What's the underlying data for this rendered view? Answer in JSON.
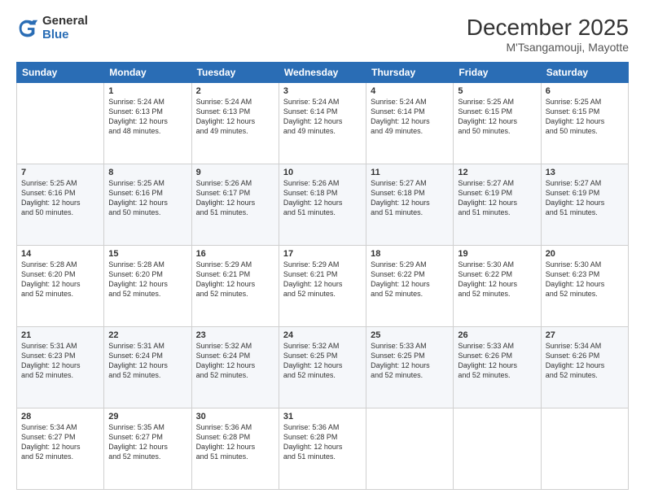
{
  "logo": {
    "line1": "General",
    "line2": "Blue"
  },
  "title": "December 2025",
  "subtitle": "M'Tsangamouji, Mayotte",
  "days_of_week": [
    "Sunday",
    "Monday",
    "Tuesday",
    "Wednesday",
    "Thursday",
    "Friday",
    "Saturday"
  ],
  "weeks": [
    [
      {
        "day": "",
        "info": ""
      },
      {
        "day": "1",
        "info": "Sunrise: 5:24 AM\nSunset: 6:13 PM\nDaylight: 12 hours\nand 48 minutes."
      },
      {
        "day": "2",
        "info": "Sunrise: 5:24 AM\nSunset: 6:13 PM\nDaylight: 12 hours\nand 49 minutes."
      },
      {
        "day": "3",
        "info": "Sunrise: 5:24 AM\nSunset: 6:14 PM\nDaylight: 12 hours\nand 49 minutes."
      },
      {
        "day": "4",
        "info": "Sunrise: 5:24 AM\nSunset: 6:14 PM\nDaylight: 12 hours\nand 49 minutes."
      },
      {
        "day": "5",
        "info": "Sunrise: 5:25 AM\nSunset: 6:15 PM\nDaylight: 12 hours\nand 50 minutes."
      },
      {
        "day": "6",
        "info": "Sunrise: 5:25 AM\nSunset: 6:15 PM\nDaylight: 12 hours\nand 50 minutes."
      }
    ],
    [
      {
        "day": "7",
        "info": "Sunrise: 5:25 AM\nSunset: 6:16 PM\nDaylight: 12 hours\nand 50 minutes."
      },
      {
        "day": "8",
        "info": "Sunrise: 5:25 AM\nSunset: 6:16 PM\nDaylight: 12 hours\nand 50 minutes."
      },
      {
        "day": "9",
        "info": "Sunrise: 5:26 AM\nSunset: 6:17 PM\nDaylight: 12 hours\nand 51 minutes."
      },
      {
        "day": "10",
        "info": "Sunrise: 5:26 AM\nSunset: 6:18 PM\nDaylight: 12 hours\nand 51 minutes."
      },
      {
        "day": "11",
        "info": "Sunrise: 5:27 AM\nSunset: 6:18 PM\nDaylight: 12 hours\nand 51 minutes."
      },
      {
        "day": "12",
        "info": "Sunrise: 5:27 AM\nSunset: 6:19 PM\nDaylight: 12 hours\nand 51 minutes."
      },
      {
        "day": "13",
        "info": "Sunrise: 5:27 AM\nSunset: 6:19 PM\nDaylight: 12 hours\nand 51 minutes."
      }
    ],
    [
      {
        "day": "14",
        "info": "Sunrise: 5:28 AM\nSunset: 6:20 PM\nDaylight: 12 hours\nand 52 minutes."
      },
      {
        "day": "15",
        "info": "Sunrise: 5:28 AM\nSunset: 6:20 PM\nDaylight: 12 hours\nand 52 minutes."
      },
      {
        "day": "16",
        "info": "Sunrise: 5:29 AM\nSunset: 6:21 PM\nDaylight: 12 hours\nand 52 minutes."
      },
      {
        "day": "17",
        "info": "Sunrise: 5:29 AM\nSunset: 6:21 PM\nDaylight: 12 hours\nand 52 minutes."
      },
      {
        "day": "18",
        "info": "Sunrise: 5:29 AM\nSunset: 6:22 PM\nDaylight: 12 hours\nand 52 minutes."
      },
      {
        "day": "19",
        "info": "Sunrise: 5:30 AM\nSunset: 6:22 PM\nDaylight: 12 hours\nand 52 minutes."
      },
      {
        "day": "20",
        "info": "Sunrise: 5:30 AM\nSunset: 6:23 PM\nDaylight: 12 hours\nand 52 minutes."
      }
    ],
    [
      {
        "day": "21",
        "info": "Sunrise: 5:31 AM\nSunset: 6:23 PM\nDaylight: 12 hours\nand 52 minutes."
      },
      {
        "day": "22",
        "info": "Sunrise: 5:31 AM\nSunset: 6:24 PM\nDaylight: 12 hours\nand 52 minutes."
      },
      {
        "day": "23",
        "info": "Sunrise: 5:32 AM\nSunset: 6:24 PM\nDaylight: 12 hours\nand 52 minutes."
      },
      {
        "day": "24",
        "info": "Sunrise: 5:32 AM\nSunset: 6:25 PM\nDaylight: 12 hours\nand 52 minutes."
      },
      {
        "day": "25",
        "info": "Sunrise: 5:33 AM\nSunset: 6:25 PM\nDaylight: 12 hours\nand 52 minutes."
      },
      {
        "day": "26",
        "info": "Sunrise: 5:33 AM\nSunset: 6:26 PM\nDaylight: 12 hours\nand 52 minutes."
      },
      {
        "day": "27",
        "info": "Sunrise: 5:34 AM\nSunset: 6:26 PM\nDaylight: 12 hours\nand 52 minutes."
      }
    ],
    [
      {
        "day": "28",
        "info": "Sunrise: 5:34 AM\nSunset: 6:27 PM\nDaylight: 12 hours\nand 52 minutes."
      },
      {
        "day": "29",
        "info": "Sunrise: 5:35 AM\nSunset: 6:27 PM\nDaylight: 12 hours\nand 52 minutes."
      },
      {
        "day": "30",
        "info": "Sunrise: 5:36 AM\nSunset: 6:28 PM\nDaylight: 12 hours\nand 51 minutes."
      },
      {
        "day": "31",
        "info": "Sunrise: 5:36 AM\nSunset: 6:28 PM\nDaylight: 12 hours\nand 51 minutes."
      },
      {
        "day": "",
        "info": ""
      },
      {
        "day": "",
        "info": ""
      },
      {
        "day": "",
        "info": ""
      }
    ]
  ]
}
